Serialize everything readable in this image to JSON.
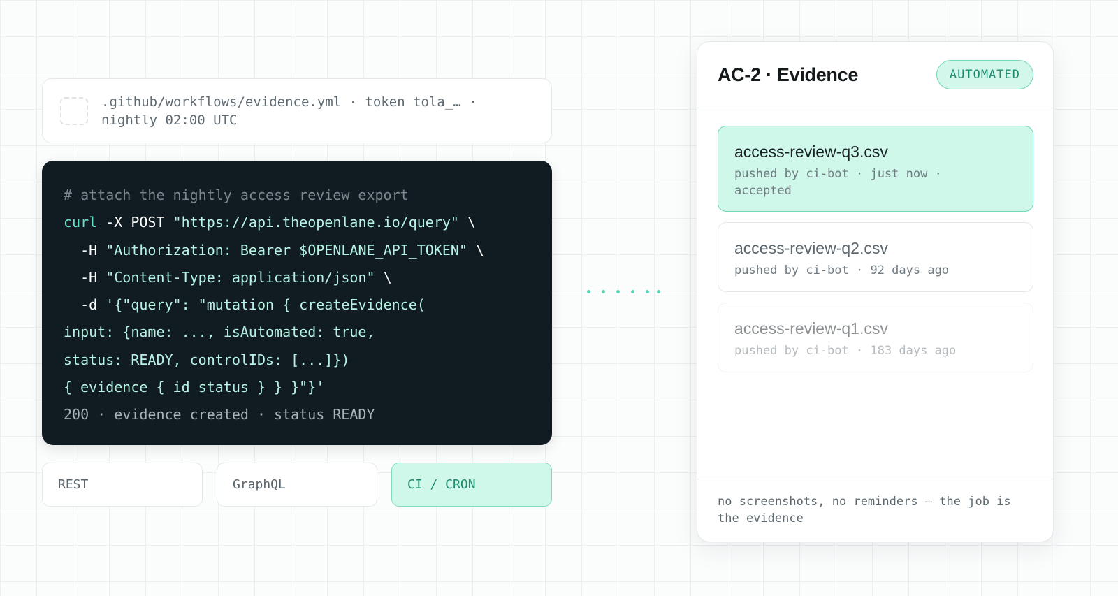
{
  "source": {
    "text": ".github/workflows/evidence.yml · token tola_… · nightly 02:00 UTC"
  },
  "code": {
    "comment": "# attach the nightly access review export",
    "cmd": "curl",
    "line1_flags": " -X POST ",
    "url": "\"https://api.theopenlane.io/query\"",
    "line1_end": " \\",
    "line2_flag": "  -H ",
    "line2_str": "\"Authorization: Bearer $OPENLANE_API_TOKEN\"",
    "line2_end": " \\",
    "line3_flag": "  -H ",
    "line3_str": "\"Content-Type: application/json\"",
    "line3_end": " \\",
    "line4_flag": "  -d ",
    "line4_str": "'{\"query\": \"mutation { createEvidence(",
    "line5": "input: {name: ..., isAutomated: true,",
    "line6": "status: READY, controlIDs: [...]})",
    "line7": "{ evidence { id status } } }\"}'",
    "result": "200 · evidence created · status READY"
  },
  "tabs": [
    {
      "label": "REST",
      "active": false
    },
    {
      "label": "GraphQL",
      "active": false
    },
    {
      "label": "CI / CRON",
      "active": true
    }
  ],
  "panel": {
    "title": "AC-2 · Evidence",
    "badge": "AUTOMATED",
    "items": [
      {
        "name": "access-review-q3.csv",
        "meta": "pushed by ci-bot · just now · accepted"
      },
      {
        "name": "access-review-q2.csv",
        "meta": "pushed by ci-bot · 92 days ago"
      },
      {
        "name": "access-review-q1.csv",
        "meta": "pushed by ci-bot · 183 days ago"
      }
    ],
    "footer": "no screenshots, no reminders — the job is the evidence"
  },
  "colors": {
    "accent": "#5fe3c4",
    "accent_bg": "#cff7ea",
    "code_bg": "#111b22"
  }
}
